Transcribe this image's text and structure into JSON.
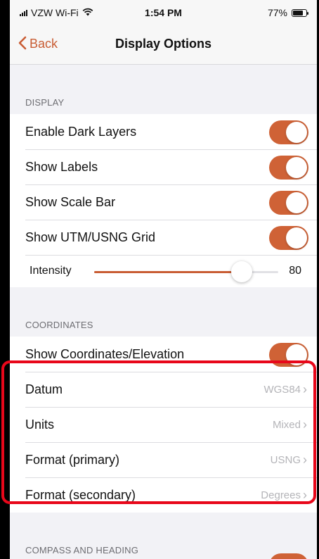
{
  "status_bar": {
    "carrier": "VZW Wi-Fi",
    "time": "1:54 PM",
    "battery": "77%",
    "battery_level": 0.77
  },
  "nav": {
    "back_label": "Back",
    "title": "Display Options"
  },
  "display": {
    "header": "DISPLAY",
    "items": [
      {
        "label": "Enable Dark Layers",
        "on": true
      },
      {
        "label": "Show Labels",
        "on": true
      },
      {
        "label": "Show Scale Bar",
        "on": true
      },
      {
        "label": "Show UTM/USNG Grid",
        "on": true
      }
    ],
    "intensity": {
      "label": "Intensity",
      "value": "80",
      "fraction": 0.8
    }
  },
  "coordinates": {
    "header": "COORDINATES",
    "toggle": {
      "label": "Show Coordinates/Elevation",
      "on": true
    },
    "options": [
      {
        "label": "Datum",
        "value": "WGS84"
      },
      {
        "label": "Units",
        "value": "Mixed"
      },
      {
        "label": "Format (primary)",
        "value": "USNG"
      },
      {
        "label": "Format (secondary)",
        "value": "Degrees"
      }
    ]
  },
  "compass": {
    "header": "COMPASS AND HEADING"
  },
  "colors": {
    "accent": "#cf6236",
    "highlight": "#e8071a"
  },
  "icons": {
    "back": "chevron-left-icon",
    "disclosure": "chevron-right-icon",
    "wifi": "wifi-icon",
    "signal": "signal-icon",
    "battery": "battery-icon"
  }
}
